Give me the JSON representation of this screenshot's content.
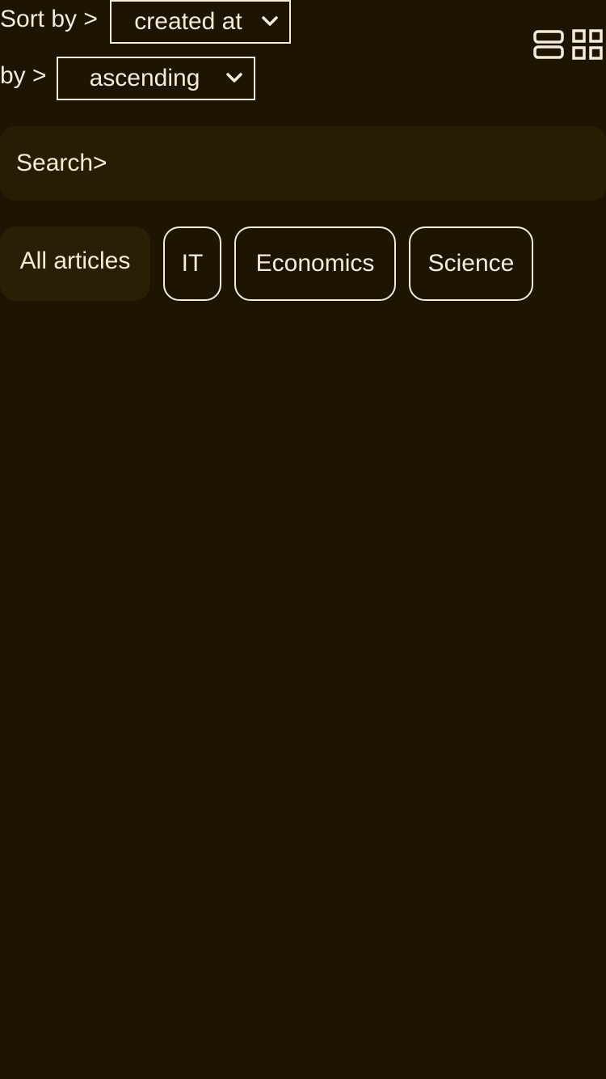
{
  "sort": {
    "field_label": "Sort by >",
    "field_value": "created at",
    "order_label": "by >",
    "order_value": "ascending"
  },
  "view_toggle": {
    "list_icon": "list-view-icon",
    "grid_icon": "grid-view-icon"
  },
  "search": {
    "placeholder": "Search>"
  },
  "categories": [
    {
      "label": "All articles",
      "active": true
    },
    {
      "label": "IT",
      "active": false
    },
    {
      "label": "Economics",
      "active": false
    },
    {
      "label": "Science",
      "active": false
    }
  ],
  "colors": {
    "background": "#1d1502",
    "surface": "#281d03",
    "foreground": "#f4ecd9"
  }
}
